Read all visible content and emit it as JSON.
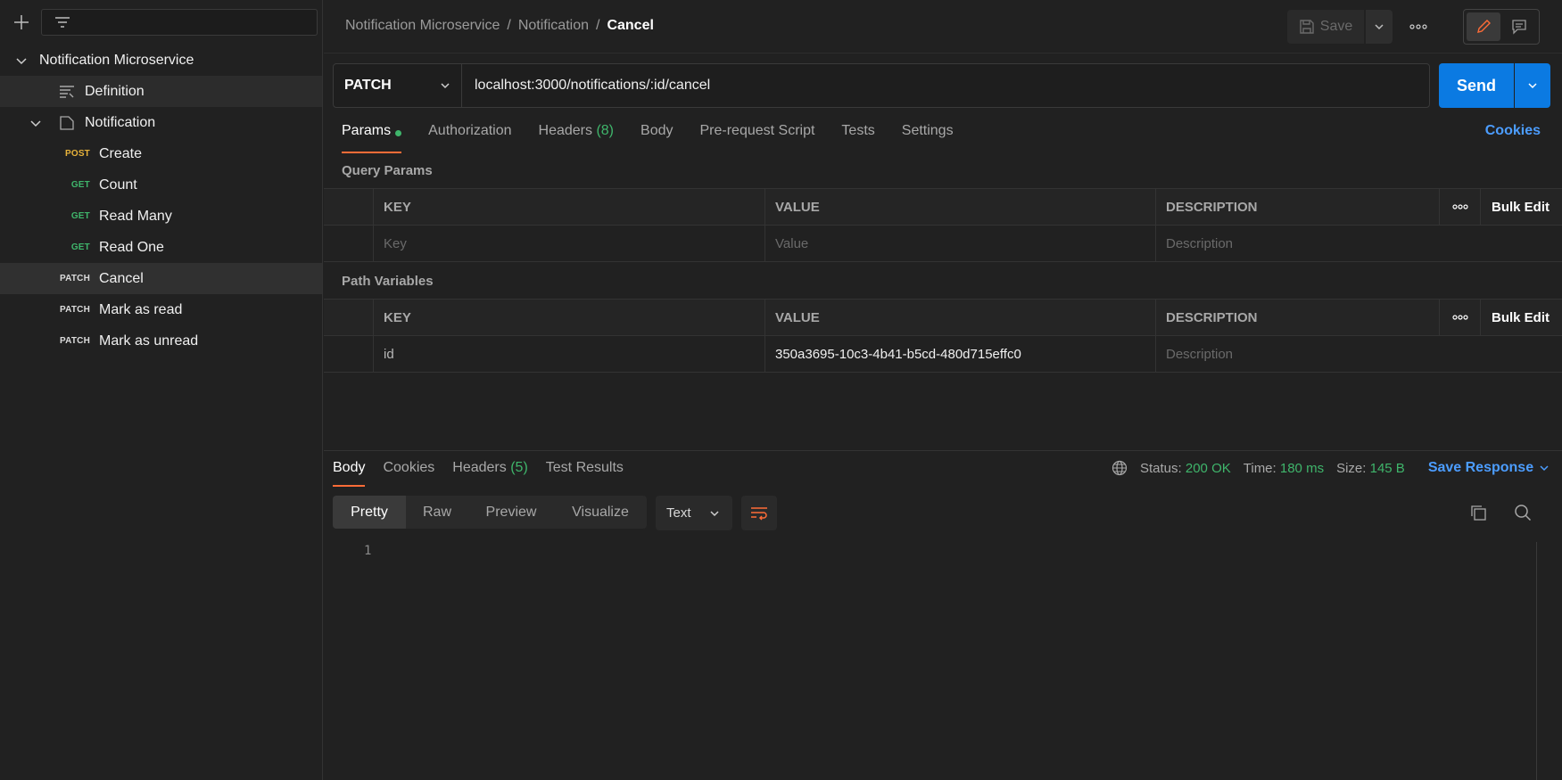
{
  "sidebar": {
    "filter_placeholder": "",
    "tree": {
      "collection": "Notification Microservice",
      "definition": "Definition",
      "folder": "Notification",
      "requests": [
        {
          "method": "POST",
          "name": "Create"
        },
        {
          "method": "GET",
          "name": "Count"
        },
        {
          "method": "GET",
          "name": "Read Many"
        },
        {
          "method": "GET",
          "name": "Read One"
        },
        {
          "method": "PATCH",
          "name": "Cancel"
        },
        {
          "method": "PATCH",
          "name": "Mark as read"
        },
        {
          "method": "PATCH",
          "name": "Mark as unread"
        }
      ]
    }
  },
  "header": {
    "breadcrumb": [
      "Notification Microservice",
      "/",
      "Notification",
      "/",
      "Cancel"
    ],
    "save_label": "Save"
  },
  "request": {
    "method": "PATCH",
    "url": "localhost:3000/notifications/:id/cancel",
    "send_label": "Send",
    "tabs": {
      "params": "Params",
      "authorization": "Authorization",
      "headers": "Headers",
      "headers_count": "(8)",
      "body": "Body",
      "pre_request": "Pre-request Script",
      "tests": "Tests",
      "settings": "Settings"
    },
    "cookies_link": "Cookies"
  },
  "query_params": {
    "title": "Query Params",
    "columns": [
      "KEY",
      "VALUE",
      "DESCRIPTION"
    ],
    "bulk_edit": "Bulk Edit",
    "placeholders": {
      "key": "Key",
      "value": "Value",
      "description": "Description"
    }
  },
  "path_variables": {
    "title": "Path Variables",
    "columns": [
      "KEY",
      "VALUE",
      "DESCRIPTION"
    ],
    "bulk_edit": "Bulk Edit",
    "rows": [
      {
        "key": "id",
        "value": "350a3695-10c3-4b41-b5cd-480d715effc0",
        "description_placeholder": "Description"
      }
    ]
  },
  "response": {
    "tabs": {
      "body": "Body",
      "cookies": "Cookies",
      "headers": "Headers",
      "headers_count": "(5)",
      "test_results": "Test Results"
    },
    "status_label": "Status:",
    "status_value": "200 OK",
    "time_label": "Time:",
    "time_value": "180 ms",
    "size_label": "Size:",
    "size_value": "145 B",
    "save_response": "Save Response",
    "views": [
      "Pretty",
      "Raw",
      "Preview",
      "Visualize"
    ],
    "format": "Text",
    "line_number": "1"
  },
  "colors": {
    "accent_orange": "#ff6c37",
    "send_blue": "#0b7ae2",
    "link_blue": "#4c9dff",
    "status_green": "#3fb56b",
    "post_yellow": "#e8b33b"
  }
}
